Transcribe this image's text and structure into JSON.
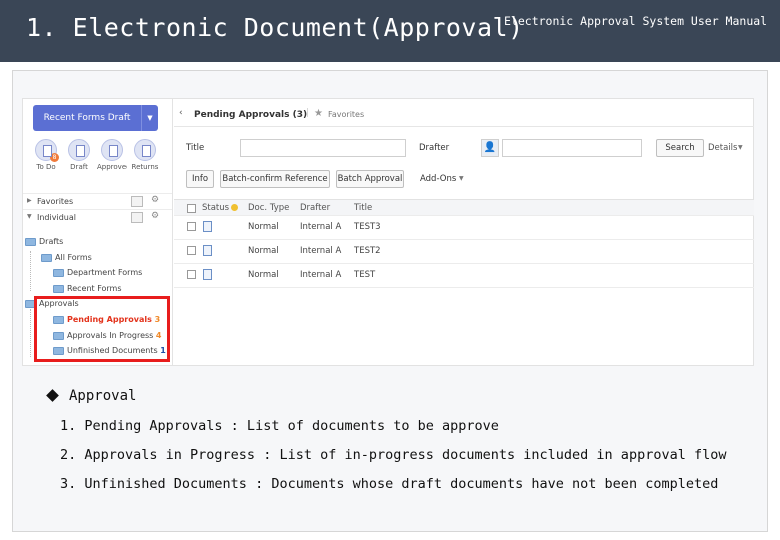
{
  "slide": {
    "title": "1. Electronic Document(Approval)",
    "subtitle": "Electronic Approval System User Manual"
  },
  "app": {
    "left_panel": {
      "draft_button": "Recent Forms Draft",
      "draft_split_icon": "chevron-down-icon",
      "quick_icons": [
        {
          "icon": "todo-icon",
          "caption": "To Do",
          "badge": "8"
        },
        {
          "icon": "draft-icon",
          "caption": "Draft"
        },
        {
          "icon": "approved-icon",
          "caption": "Approved"
        },
        {
          "icon": "return-icon",
          "caption": "Returns"
        }
      ],
      "rows": [
        {
          "label": "Favorites"
        },
        {
          "label": "Individual"
        }
      ],
      "tree": {
        "drafts": "Drafts",
        "all_forms": "All Forms",
        "department_forms": "Department Forms",
        "recent_forms": "Recent Forms",
        "approvals": "Approvals",
        "pending_label": "Pending Approvals",
        "pending_count": "3",
        "in_progress_label": "Approvals In Progress",
        "in_progress_count": "4",
        "unfinished_label": "Unfinished Documents",
        "unfinished_count": "1"
      }
    },
    "right_panel": {
      "header_title": "Pending Approvals (3)",
      "favorites_label": "Favorites",
      "title_label": "Title",
      "drafter_label": "Drafter",
      "search_button": "Search",
      "details_label": "Details",
      "buttons": {
        "info": "Info",
        "batch_confirm": "Batch-confirm Reference",
        "batch_approve": "Batch Approval",
        "add_ons": "Add-Ons"
      },
      "columns": [
        "Status",
        "Doc. Type",
        "Drafter",
        "Title"
      ],
      "rows": [
        {
          "type": "Normal",
          "drafter": "Internal A",
          "title": "TEST3"
        },
        {
          "type": "Normal",
          "drafter": "Internal A",
          "title": "TEST2"
        },
        {
          "type": "Normal",
          "drafter": "Internal A",
          "title": "TEST"
        }
      ]
    }
  },
  "description": {
    "heading": "Approval",
    "items": [
      "1. Pending Approvals : List of documents to be approve",
      "2. Approvals in Progress : List of in-progress documents included in approval flow",
      "3. Unfinished Documents : Documents whose draft documents have not been completed"
    ]
  },
  "colors": {
    "header_bg": "#3a4656",
    "primary_button": "#5b6fd3",
    "highlight_box": "#e81d1d",
    "badge": "#f07a3a",
    "link_blue": "#1e4fa8"
  }
}
